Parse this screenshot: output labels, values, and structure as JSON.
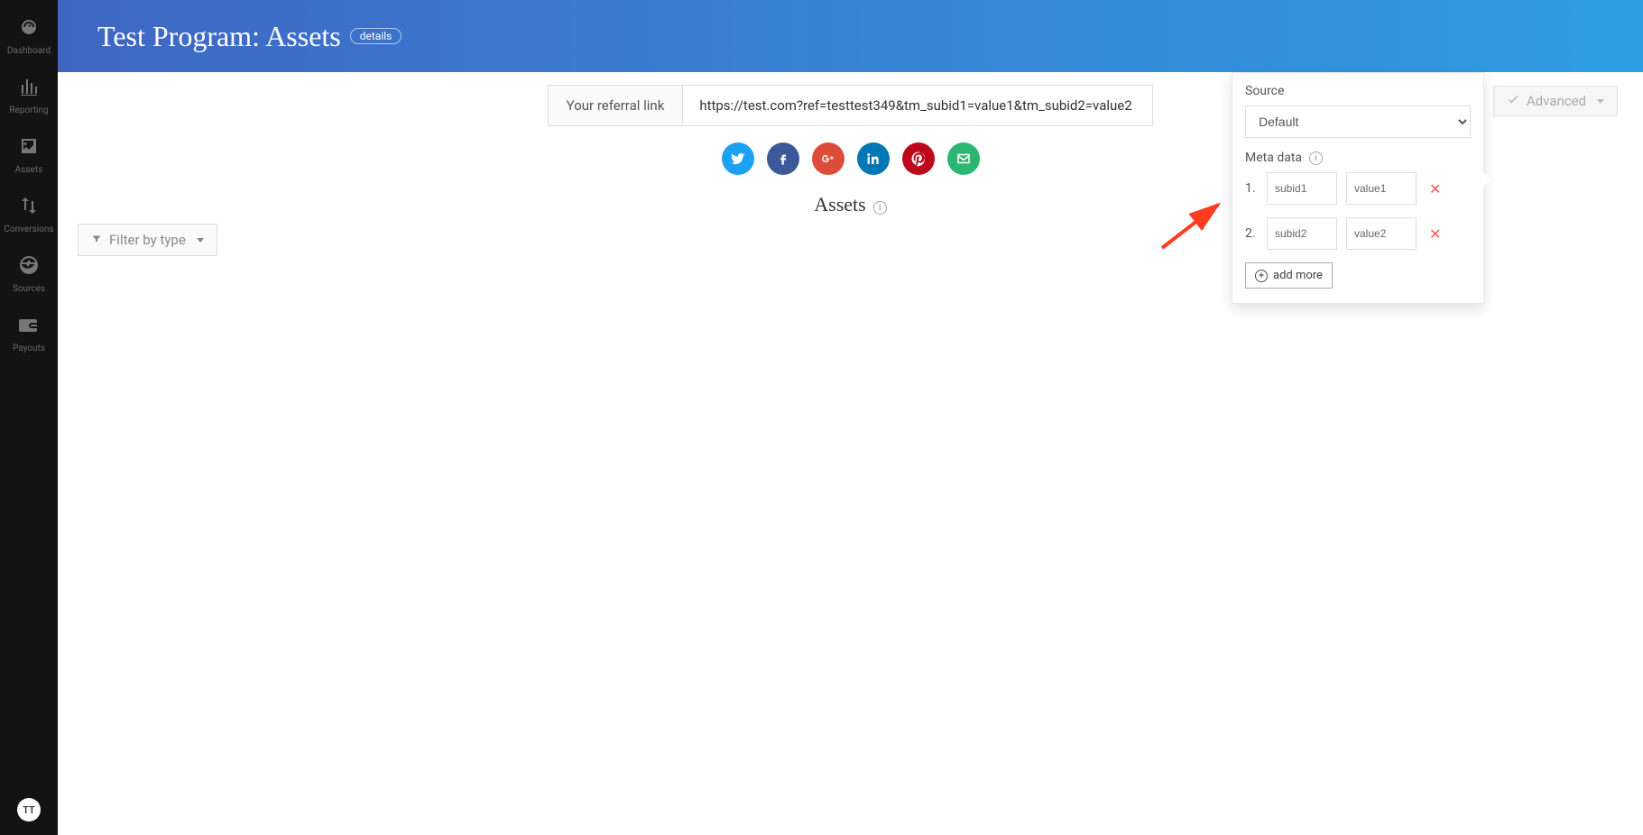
{
  "sidebar": {
    "items": [
      {
        "label": "Dashboard"
      },
      {
        "label": "Reporting"
      },
      {
        "label": "Assets"
      },
      {
        "label": "Conversions"
      },
      {
        "label": "Sources"
      },
      {
        "label": "Payouts"
      }
    ],
    "avatar_initials": "TT"
  },
  "header": {
    "title": "Test Program: Assets",
    "details_label": "details"
  },
  "referral": {
    "label": "Your referral link",
    "url": "https://test.com?ref=testtest349&tm_subid1=value1&tm_subid2=value2"
  },
  "social": {
    "twitter": "twitter-icon",
    "facebook": "facebook-icon",
    "gplus": "google-plus-icon",
    "linkedin": "linkedin-icon",
    "pinterest": "pinterest-icon",
    "email": "email-icon"
  },
  "assets": {
    "heading": "Assets",
    "filter_label": "Filter by type"
  },
  "advanced": {
    "label": "Advanced"
  },
  "panel": {
    "source_label": "Source",
    "source_value": "Default",
    "meta_label": "Meta data",
    "rows": [
      {
        "num": "1.",
        "key": "subid1",
        "val": "value1"
      },
      {
        "num": "2.",
        "key": "subid2",
        "val": "value2"
      }
    ],
    "add_more_label": "add more"
  }
}
